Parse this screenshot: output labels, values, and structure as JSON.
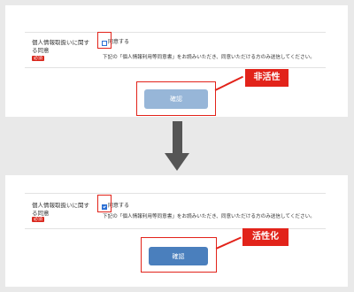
{
  "top_form": {
    "label_line1": "個人情報取扱いに関す",
    "label_line2": "る同意",
    "required_badge": "必須",
    "checkbox_label": "同意する",
    "checkbox_checked": false,
    "description": "下記の「個人情報利用等同意書」をお読みいただき、同意いただける方のみ送信してください。",
    "submit_label": "確認",
    "submit_state": "disabled",
    "callout_text": "非活性"
  },
  "bottom_form": {
    "label_line1": "個人情報取扱いに関す",
    "label_line2": "る同意",
    "required_badge": "必須",
    "checkbox_label": "同意する",
    "checkbox_checked": true,
    "description": "下記の「個人情報利用等同意書」をお読みいただき、同意いただける方のみ送信してください。",
    "submit_label": "確認",
    "submit_state": "enabled",
    "callout_text": "活性化"
  },
  "colors": {
    "annotation_red": "#e2231a",
    "button_disabled": "#97b6d8",
    "button_enabled": "#4a7fbd",
    "arrow": "#555555"
  },
  "transition_arrow_icon": "arrow-down-icon"
}
